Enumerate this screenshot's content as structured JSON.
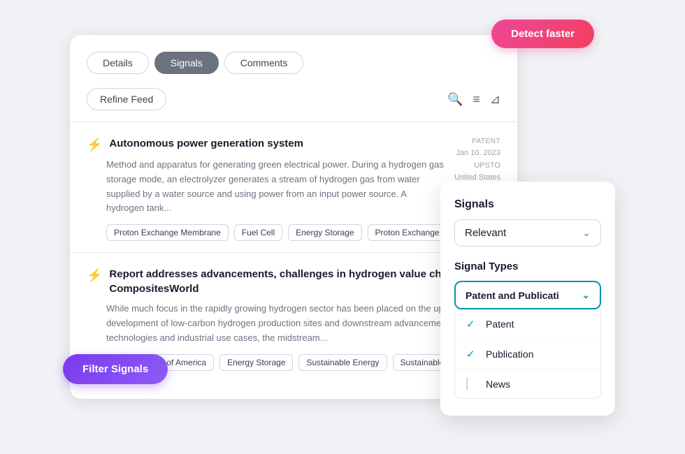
{
  "detect_faster_label": "Detect faster",
  "filter_signals_label": "Filter Signals",
  "tabs": [
    {
      "id": "details",
      "label": "Details"
    },
    {
      "id": "signals",
      "label": "Signals",
      "active": true
    },
    {
      "id": "comments",
      "label": "Comments"
    }
  ],
  "refine_feed_label": "Refine Feed",
  "signals": [
    {
      "id": 1,
      "icon": "⚡",
      "title": "Autonomous power generation system",
      "description": "Method and apparatus for generating green electrical power. During a hydrogen gas storage mode, an electrolyzer generates a stream of hydrogen gas from water supplied by a water source and using power from an input power source. A hydrogen tank...",
      "tags": [
        "Proton Exchange Membrane",
        "Fuel Cell",
        "Energy Storage",
        "Proton Exchange Me..."
      ],
      "meta_type": "PATENT",
      "meta_date": "Jan 10, 2023",
      "meta_org": "UPSTO",
      "meta_country": "United States"
    },
    {
      "id": 2,
      "icon": "⚡",
      "title": "Report addresses advancements, challenges in hydrogen value chain | CompositesWorld",
      "description": "While much focus in the rapidly growing hydrogen sector has been placed on the upstream development of low-carbon hydrogen production sites and downstream advancements in fuel cell technologies and industrial use cases, the midstream...",
      "tags": [
        "United States of America",
        "Energy Storage",
        "Sustainable Energy",
        "Sustainable ..."
      ]
    }
  ],
  "filter_panel": {
    "signals_label": "Signals",
    "relevant_label": "Relevant",
    "signal_types_label": "Signal Types",
    "signal_types_value": "Patent and Publicati",
    "options": [
      {
        "id": "patent",
        "label": "Patent",
        "checked": true
      },
      {
        "id": "publication",
        "label": "Publication",
        "checked": true
      },
      {
        "id": "news",
        "label": "News",
        "checked": false
      }
    ]
  }
}
